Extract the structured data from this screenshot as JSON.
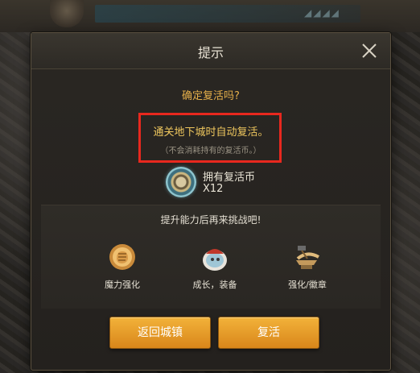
{
  "dialog": {
    "title": "提示",
    "confirm_question": "确定复活吗?",
    "auto_revive_text": "通关地下城时自动复活。",
    "auto_revive_note": "（不会消耗持有的复活币。）",
    "coin_label": "拥有复活币",
    "coin_count": "X12",
    "advice_text": "提升能力后再来挑战吧!",
    "options": [
      {
        "label": "魔力强化",
        "icon": "fist-icon"
      },
      {
        "label": "成长，装备",
        "icon": "pet-egg-icon"
      },
      {
        "label": "强化/徽章",
        "icon": "anvil-hammer-icon"
      }
    ],
    "buttons": {
      "return_label": "返回城镇",
      "revive_label": "复活"
    }
  },
  "colors": {
    "accent_orange": "#e6b04a",
    "button_orange": "#f2b23a",
    "highlight_red": "#e8281e"
  }
}
